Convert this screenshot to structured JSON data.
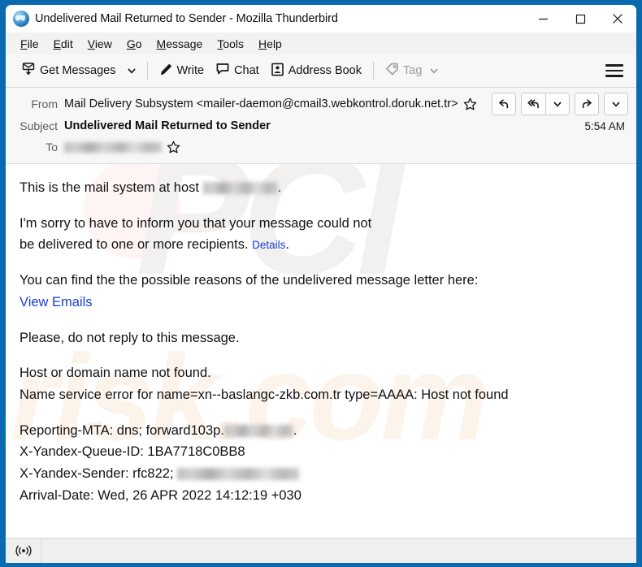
{
  "window": {
    "title": "Undelivered Mail Returned to Sender - Mozilla Thunderbird",
    "logo_icon": "thunderbird-logo-icon",
    "controls": {
      "minimize": "minimize-icon",
      "maximize": "maximize-icon",
      "close": "close-icon"
    },
    "border_color": "#0a6ab0"
  },
  "menubar": {
    "items": [
      {
        "label": "File",
        "accel": "F"
      },
      {
        "label": "Edit",
        "accel": "E"
      },
      {
        "label": "View",
        "accel": "V"
      },
      {
        "label": "Go",
        "accel": "G"
      },
      {
        "label": "Message",
        "accel": "M"
      },
      {
        "label": "Tools",
        "accel": "T"
      },
      {
        "label": "Help",
        "accel": "H"
      }
    ]
  },
  "toolbar": {
    "get_messages": {
      "label": "Get Messages",
      "icon": "get-messages-icon"
    },
    "get_messages_chevron": "chevron-down-icon",
    "write": {
      "label": "Write",
      "icon": "pencil-icon"
    },
    "chat": {
      "label": "Chat",
      "icon": "chat-bubble-icon"
    },
    "address_book": {
      "label": "Address Book",
      "icon": "address-book-icon"
    },
    "tag": {
      "label": "Tag",
      "icon": "tag-icon",
      "disabled": true
    },
    "tag_chevron": "chevron-down-icon",
    "app_menu": "hamburger-menu-icon"
  },
  "message_header": {
    "from_label": "From",
    "from_value": "Mail Delivery Subsystem <mailer-daemon@cmail3.webkontrol.doruk.net.tr>",
    "from_star": "star-icon",
    "subject_label": "Subject",
    "subject_value": "Undelivered Mail Returned to Sender",
    "time": "5:54 AM",
    "to_label": "To",
    "to_value_redacted": "redacted-recipient-address",
    "to_star": "star-icon",
    "actions": {
      "reply": "reply-icon",
      "reply_all": "reply-all-icon",
      "reply_all_chevron": "chevron-down-icon",
      "forward": "forward-icon",
      "more_chevron": "chevron-down-icon"
    }
  },
  "body": {
    "line1_pre": "This is the mail system at host ",
    "line1_redacted": "redacted-host-domain",
    "line1_post": ".",
    "line2": "I'm sorry to have to inform you that your message could not",
    "line3_pre": "be delivered to one or more recipients. ",
    "line3_link": "Details",
    "line3_post": ".",
    "line4": "You can find the the possible reasons of the undelivered message letter here:",
    "line5_link": "View Emails",
    "line6": "Please, do not reply to this message.",
    "line7": "Host or domain name not found.",
    "line8": "Name service error for name=xn--baslangc-zkb.com.tr type=AAAA: Host not found",
    "line9_pre": "Reporting-MTA: dns; forward103p.",
    "line9_redacted": "redacted-host-domain",
    "line9_post": ".",
    "line10": "X-Yandex-Queue-ID: 1BA7718C0BB8",
    "line11_pre": "X-Yandex-Sender: rfc822; ",
    "line11_redacted": "redacted-sender-address",
    "line12": "Arrival-Date: Wed, 26 APR 2022 14:12:19 +030",
    "link_color": "#1a3fd4"
  },
  "watermark": {
    "top_text": "PCI",
    "bottom_text": "risk.com"
  },
  "statusbar": {
    "connectivity_icon": "broadcast-icon"
  }
}
